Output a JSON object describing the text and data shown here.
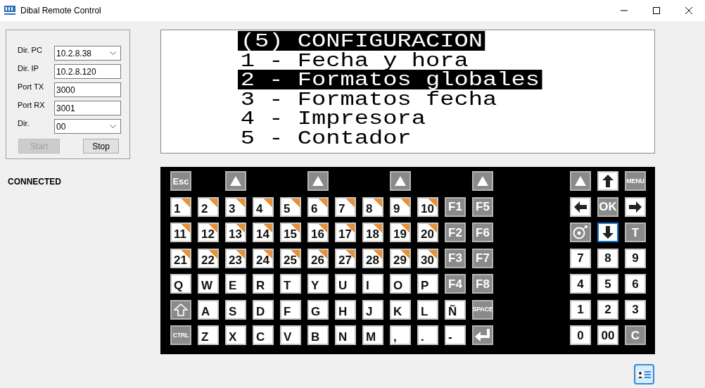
{
  "window": {
    "title": "Dibal Remote Control"
  },
  "connection": {
    "fields": [
      {
        "label": "Dir. PC",
        "value": "10.2.8.38",
        "kind": "dropdown"
      },
      {
        "label": "Dir. IP",
        "value": "10.2.8.120",
        "kind": "text"
      },
      {
        "label": "Port TX",
        "value": "3000",
        "kind": "text"
      },
      {
        "label": "Port RX",
        "value": "3001",
        "kind": "text"
      },
      {
        "label": "Dir.",
        "value": "00",
        "kind": "dropdown"
      }
    ],
    "buttons": [
      {
        "label": "Start",
        "disabled": true
      },
      {
        "label": "Stop",
        "disabled": false
      }
    ],
    "status": "CONNECTED"
  },
  "display": {
    "lines": [
      {
        "text": "(5) CONFIGURACION",
        "highlighted": true
      },
      {
        "text": "1 - Fecha y hora",
        "highlighted": false
      },
      {
        "text": "2 - Formatos globales",
        "highlighted": true
      },
      {
        "text": "3 - Formatos fecha",
        "highlighted": false
      },
      {
        "text": "4 - Impresora",
        "highlighted": false
      },
      {
        "text": "5 - Contador",
        "highlighted": false
      }
    ]
  },
  "keyboard": {
    "main_keys": [
      [
        {
          "kind": "func",
          "label": "Esc"
        },
        {
          "kind": "blank"
        },
        {
          "kind": "up"
        },
        {
          "kind": "blank"
        },
        {
          "kind": "blank"
        },
        {
          "kind": "up"
        },
        {
          "kind": "blank"
        },
        {
          "kind": "blank"
        },
        {
          "kind": "up"
        },
        {
          "kind": "blank"
        },
        {
          "kind": "blank"
        },
        {
          "kind": "up"
        }
      ],
      [
        {
          "kind": "preset",
          "label": "1"
        },
        {
          "kind": "preset",
          "label": "2"
        },
        {
          "kind": "preset",
          "label": "3"
        },
        {
          "kind": "preset",
          "label": "4"
        },
        {
          "kind": "preset",
          "label": "5"
        },
        {
          "kind": "preset",
          "label": "6"
        },
        {
          "kind": "preset",
          "label": "7"
        },
        {
          "kind": "preset",
          "label": "8"
        },
        {
          "kind": "preset",
          "label": "9"
        },
        {
          "kind": "preset",
          "label": "10"
        },
        {
          "kind": "func",
          "label": "F1"
        },
        {
          "kind": "func",
          "label": "F5"
        }
      ],
      [
        {
          "kind": "preset",
          "label": "11"
        },
        {
          "kind": "preset",
          "label": "12"
        },
        {
          "kind": "preset",
          "label": "13"
        },
        {
          "kind": "preset",
          "label": "14"
        },
        {
          "kind": "preset",
          "label": "15"
        },
        {
          "kind": "preset",
          "label": "16"
        },
        {
          "kind": "preset",
          "label": "17"
        },
        {
          "kind": "preset",
          "label": "18"
        },
        {
          "kind": "preset",
          "label": "19"
        },
        {
          "kind": "preset",
          "label": "20"
        },
        {
          "kind": "func",
          "label": "F2"
        },
        {
          "kind": "func",
          "label": "F6"
        }
      ],
      [
        {
          "kind": "preset",
          "label": "21"
        },
        {
          "kind": "preset",
          "label": "22"
        },
        {
          "kind": "preset",
          "label": "23"
        },
        {
          "kind": "preset",
          "label": "24"
        },
        {
          "kind": "preset",
          "label": "25"
        },
        {
          "kind": "preset",
          "label": "26"
        },
        {
          "kind": "preset",
          "label": "27"
        },
        {
          "kind": "preset",
          "label": "28"
        },
        {
          "kind": "preset",
          "label": "29"
        },
        {
          "kind": "preset",
          "label": "30"
        },
        {
          "kind": "func",
          "label": "F3"
        },
        {
          "kind": "func",
          "label": "F7"
        }
      ],
      [
        {
          "kind": "char",
          "label": "Q"
        },
        {
          "kind": "char",
          "label": "W"
        },
        {
          "kind": "char",
          "label": "E"
        },
        {
          "kind": "char",
          "label": "R"
        },
        {
          "kind": "char",
          "label": "T"
        },
        {
          "kind": "char",
          "label": "Y"
        },
        {
          "kind": "char",
          "label": "U"
        },
        {
          "kind": "char",
          "label": "I"
        },
        {
          "kind": "char",
          "label": "O"
        },
        {
          "kind": "char",
          "label": "P"
        },
        {
          "kind": "func",
          "label": "F4"
        },
        {
          "kind": "func",
          "label": "F8"
        }
      ],
      [
        {
          "kind": "shift"
        },
        {
          "kind": "char",
          "label": "A"
        },
        {
          "kind": "char",
          "label": "S"
        },
        {
          "kind": "char",
          "label": "D"
        },
        {
          "kind": "char",
          "label": "F"
        },
        {
          "kind": "char",
          "label": "G"
        },
        {
          "kind": "char",
          "label": "H"
        },
        {
          "kind": "char",
          "label": "J"
        },
        {
          "kind": "char",
          "label": "K"
        },
        {
          "kind": "char",
          "label": "L"
        },
        {
          "kind": "char",
          "label": "Ñ"
        },
        {
          "kind": "func",
          "label": "SPACE"
        }
      ],
      [
        {
          "kind": "func",
          "label": "CTRL"
        },
        {
          "kind": "char",
          "label": "Z"
        },
        {
          "kind": "char",
          "label": "X"
        },
        {
          "kind": "char",
          "label": "C"
        },
        {
          "kind": "char",
          "label": "V"
        },
        {
          "kind": "char",
          "label": "B"
        },
        {
          "kind": "char",
          "label": "N"
        },
        {
          "kind": "char",
          "label": "M"
        },
        {
          "kind": "char",
          "label": ","
        },
        {
          "kind": "char",
          "label": "."
        },
        {
          "kind": "char",
          "label": "-"
        },
        {
          "kind": "enter"
        }
      ]
    ],
    "nav_keys": [
      [
        {
          "kind": "up",
          "focused": false
        },
        {
          "kind": "arrow-up",
          "focused": false
        },
        {
          "kind": "func",
          "label": "MENU",
          "focused": false
        }
      ],
      [
        {
          "kind": "arrow-left",
          "focused": false
        },
        {
          "kind": "func",
          "label": "OK",
          "focused": false
        },
        {
          "kind": "arrow-right",
          "focused": false
        }
      ],
      [
        {
          "kind": "tare",
          "focused": false
        },
        {
          "kind": "arrow-down",
          "focused": true
        },
        {
          "kind": "func",
          "label": "T",
          "focused": false
        }
      ],
      [
        {
          "kind": "char",
          "label": "7",
          "focused": false
        },
        {
          "kind": "char",
          "label": "8",
          "focused": false
        },
        {
          "kind": "char",
          "label": "9",
          "focused": false
        }
      ],
      [
        {
          "kind": "char",
          "label": "4",
          "focused": false
        },
        {
          "kind": "char",
          "label": "5",
          "focused": false
        },
        {
          "kind": "char",
          "label": "6",
          "focused": false
        }
      ],
      [
        {
          "kind": "char",
          "label": "1",
          "focused": false
        },
        {
          "kind": "char",
          "label": "2",
          "focused": false
        },
        {
          "kind": "char",
          "label": "3",
          "focused": false
        }
      ],
      [
        {
          "kind": "char",
          "label": "0",
          "focused": false
        },
        {
          "kind": "char",
          "label": "00",
          "focused": false
        },
        {
          "kind": "func",
          "label": "C",
          "focused": false
        }
      ]
    ]
  }
}
